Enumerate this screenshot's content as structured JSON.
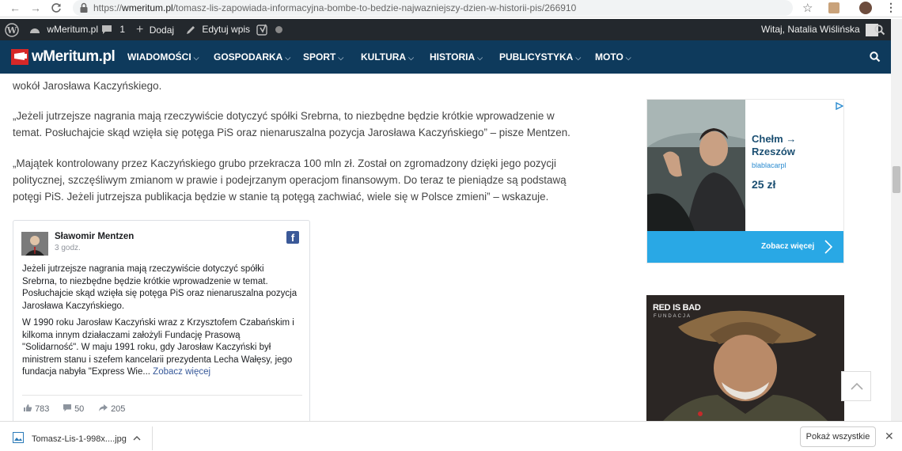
{
  "browser": {
    "url_scheme": "https://",
    "url_host": "wmeritum.pl",
    "url_path": "/tomasz-lis-zapowiada-informacyjna-bombe-to-bedzie-najwazniejszy-dzien-w-historii-pis/266910"
  },
  "admin_bar": {
    "site_name": "wMeritum.pl",
    "comments_count": "1",
    "add_label": "Dodaj",
    "edit_label": "Edytuj wpis",
    "greeting": "Witaj, Natalia Wiślińska"
  },
  "nav": {
    "logo_text": "wMeritum.pl",
    "items": [
      "WIADOMOŚCI",
      "GOSPODARKA",
      "SPORT",
      "KULTURA",
      "HISTORIA",
      "PUBLICYSTYKA",
      "MOTO"
    ]
  },
  "article": {
    "p0": "wokół Jarosława Kaczyńskiego.",
    "p1_l1": "„Jeżeli jutrzejsze nagrania mają rzeczywiście dotyczyć spółki Srebrna, to niezbędne będzie krótkie wprowadzenie w",
    "p1_l2": "temat. Posłuchajcie skąd wzięła się potęga PiS oraz nienaruszalna pozycja Jarosława Kaczyńskiego” – pisze Mentzen.",
    "p2_l1": "„Majątek kontrolowany przez Kaczyńskiego grubo przekracza 100 mln zł. Został on zgromadzony dzięki jego pozycji",
    "p2_l2": "politycznej, szczęśliwym zmianom w prawie i podejrzanym operacjom finansowym. Do teraz te pieniądze są podstawą",
    "p2_l3": "potęgi PiS. Jeżeli jutrzejsza publikacja będzie w stanie tą potęgą zachwiać, wiele się w Polsce zmieni” – wskazuje."
  },
  "fb_post": {
    "author": "Sławomir Mentzen",
    "time": "3 godz.",
    "t1": "Jeżeli jutrzejsze nagrania mają rzeczywiście dotyczyć spółki",
    "t2": "Srebrna, to niezbędne będzie krótkie wprowadzenie w temat.",
    "t3": "Posłuchajcie skąd wzięła się potęga PiS oraz nienaruszalna pozycja",
    "t4": "Jarosława Kaczyńskiego.",
    "t5": "W 1990 roku Jarosław Kaczyński wraz z Krzysztofem Czabańskim i",
    "t6": "kilkoma innym działaczami założyli Fundację Prasową",
    "t7": "\"Solidarność\". W maju 1991 roku, gdy Jarosław Kaczyński był",
    "t8": "ministrem stanu i szefem kancelarii prezydenta Lecha Wałęsy, jego",
    "t9": "fundacja nabyła \"Express Wie...",
    "see_more": "Zobacz więcej",
    "likes": "783",
    "comments": "50",
    "shares": "205"
  },
  "ad1": {
    "route_from": "Chełm →",
    "route_to": "Rzeszów",
    "brand": "blablacarpl",
    "price": "25 zł",
    "cta": "Zobacz więcej"
  },
  "ad2": {
    "title": "RED IS BAD",
    "sub": "FUNDACJA"
  },
  "download": {
    "file_name": "Tomasz-Lis-1-998x....jpg",
    "show_all": "Pokaż wszystkie"
  },
  "colors": {
    "nav_bg": "#0e3a5c",
    "admin_bg": "#23282d",
    "ad_cta": "#29a8e5",
    "fb_blue": "#3b5998"
  }
}
